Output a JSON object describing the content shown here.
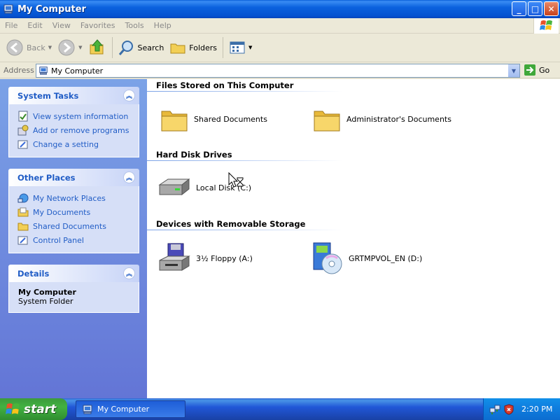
{
  "window": {
    "title": "My Computer",
    "controls": {
      "minimize": "_",
      "maximize": "□",
      "close": "✕"
    }
  },
  "menubar": [
    "File",
    "Edit",
    "View",
    "Favorites",
    "Tools",
    "Help"
  ],
  "toolbar": {
    "back": "Back",
    "search": "Search",
    "folders": "Folders"
  },
  "address": {
    "label": "Address",
    "value": "My Computer",
    "go": "Go"
  },
  "sidebar": {
    "system_tasks": {
      "title": "System Tasks",
      "items": [
        {
          "label": "View system information",
          "icon": "system-info-icon"
        },
        {
          "label": "Add or remove programs",
          "icon": "add-remove-icon"
        },
        {
          "label": "Change a setting",
          "icon": "control-panel-icon"
        }
      ]
    },
    "other_places": {
      "title": "Other Places",
      "items": [
        {
          "label": "My Network Places",
          "icon": "network-icon"
        },
        {
          "label": "My Documents",
          "icon": "documents-icon"
        },
        {
          "label": "Shared Documents",
          "icon": "folder-icon"
        },
        {
          "label": "Control Panel",
          "icon": "control-panel-icon"
        }
      ]
    },
    "details": {
      "title": "Details",
      "name": "My Computer",
      "type": "System Folder"
    }
  },
  "groups": {
    "files": {
      "title": "Files Stored on This Computer",
      "items": [
        "Shared Documents",
        "Administrator's Documents"
      ]
    },
    "hdd": {
      "title": "Hard Disk Drives",
      "items": [
        "Local Disk (C:)"
      ]
    },
    "removable": {
      "title": "Devices with Removable Storage",
      "items": [
        "3½ Floppy (A:)",
        "GRTMPVOL_EN (D:)"
      ]
    }
  },
  "taskbar": {
    "start": "start",
    "task": "My Computer",
    "clock": "2:20 PM"
  },
  "colors": {
    "title_bar": "#0b62de",
    "sidebar_link": "#215dc6",
    "start_green": "#42b142",
    "taskbar_blue": "#2157d7"
  }
}
